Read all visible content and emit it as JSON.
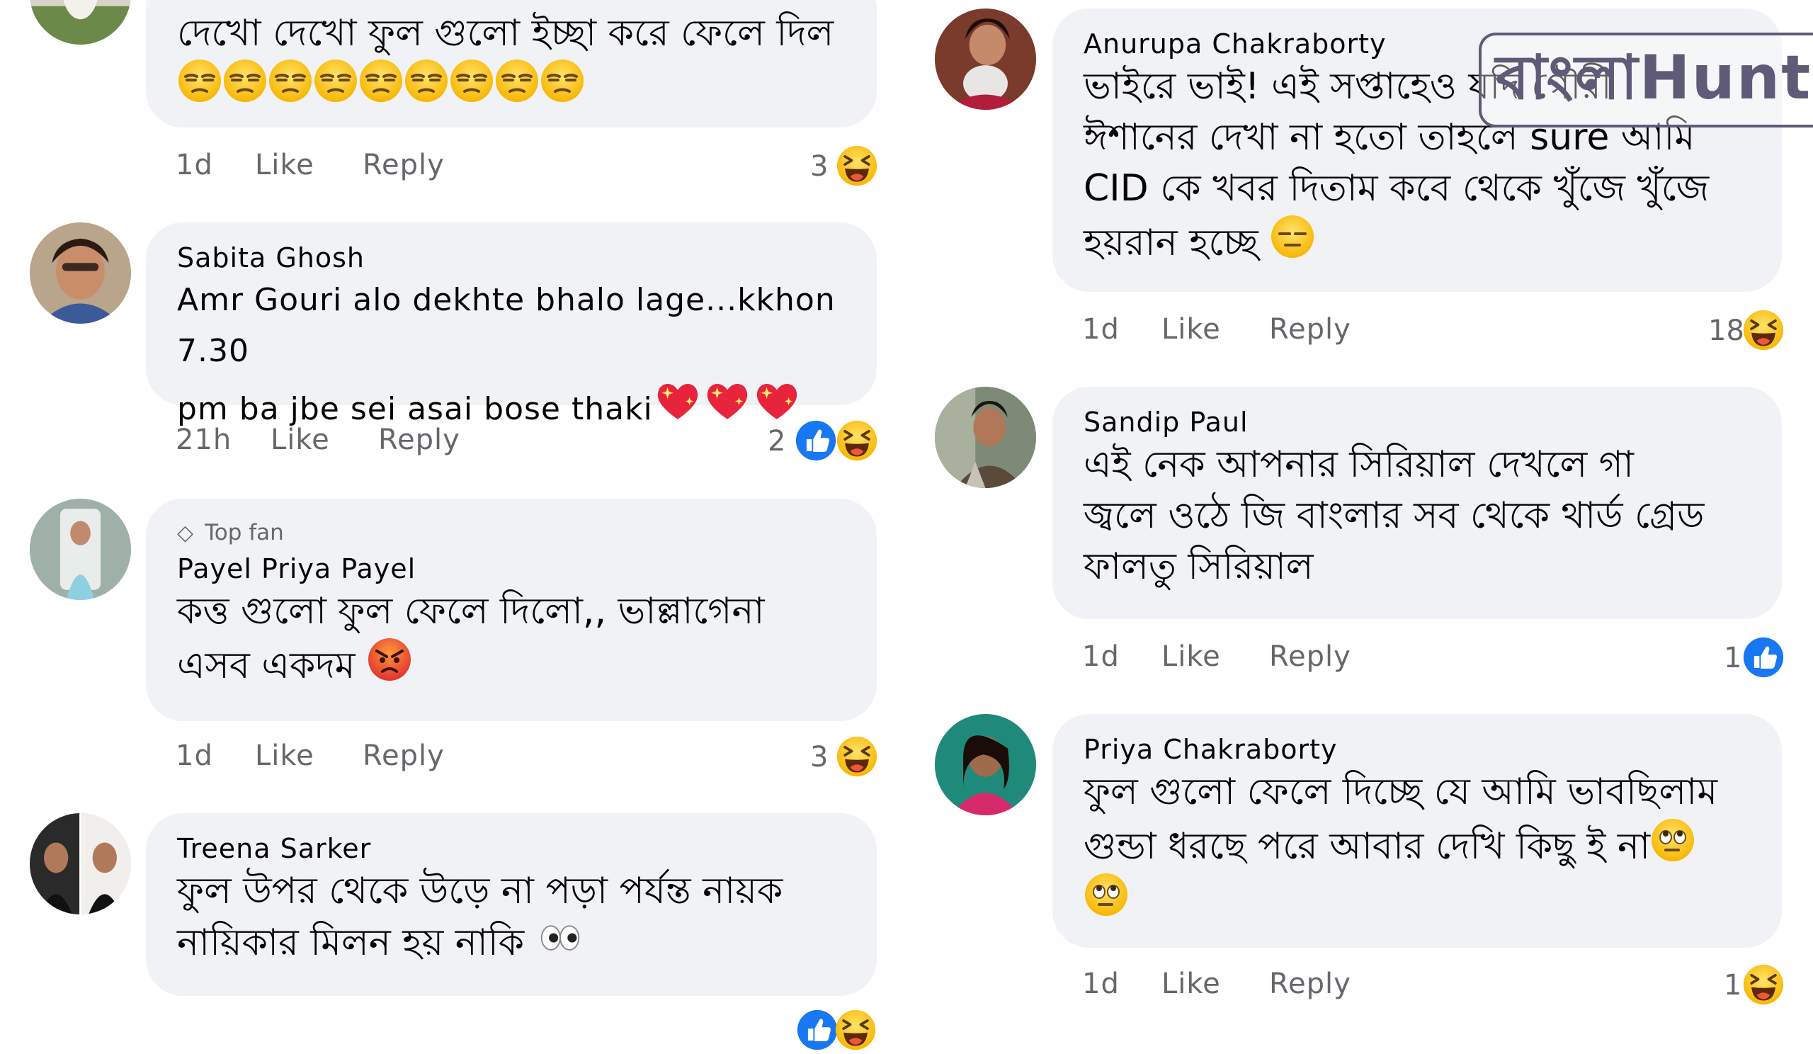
{
  "watermark": {
    "text": "বাংলাHunt"
  },
  "comments": [
    {
      "id": "c1",
      "name": "",
      "text": "দেখো দেখো ফুল গুলো ইচ্ছা করে ফেলে দিল",
      "emojis": [
        "unamused",
        "unamused",
        "unamused",
        "unamused",
        "unamused",
        "unamused",
        "unamused",
        "unamused",
        "unamused"
      ],
      "time": "1d",
      "like": "Like",
      "reply": "Reply",
      "reaction_count": "3",
      "reactions": [
        "haha"
      ]
    },
    {
      "id": "c2",
      "name": "Sabita Ghosh",
      "text_line1": "Amr Gouri alo dekhte bhalo lage...kkhon 7.30",
      "text_line2": "pm ba jbe sei asai bose thaki",
      "emojis": [
        "sparkling-heart",
        "sparkling-heart",
        "sparkling-heart"
      ],
      "time": "21h",
      "like": "Like",
      "reply": "Reply",
      "reaction_count": "2",
      "reactions": [
        "like",
        "haha"
      ]
    },
    {
      "id": "c3",
      "badge": "Top fan",
      "name": "Payel Priya Payel",
      "text_line1": "কত্ত গুলো ফুল ফেলে দিলো,, ভাল্লাগেনা",
      "text_line2": "এসব একদম",
      "emojis": [
        "angry"
      ],
      "time": "1d",
      "like": "Like",
      "reply": "Reply",
      "reaction_count": "3",
      "reactions": [
        "haha"
      ]
    },
    {
      "id": "c4",
      "name": "Treena Sarker",
      "text_line1": "ফুল উপর থেকে উড়ে না পড়া পর্যন্ত নায়ক",
      "text_line2": "নায়িকার মিলন হয় নাকি",
      "emojis": [
        "eyes"
      ]
    },
    {
      "id": "c5",
      "name": "Anurupa Chakraborty",
      "text_line1": "ভাইরে ভাই! এই সপ্তাহেও যদি গৌরী",
      "text_line2": "ঈশানের দেখা না হতো তাহলে sure আমি",
      "text_line3": "CID কে খবর দিতাম কবে থেকে খুঁজে খুঁজে",
      "text_line4": "হয়রান হচ্ছে",
      "emojis": [
        "expressionless"
      ],
      "time": "1d",
      "like": "Like",
      "reply": "Reply",
      "reaction_count": "18",
      "reactions": [
        "haha"
      ]
    },
    {
      "id": "c6",
      "name": "Sandip Paul",
      "text_line1": "এই নেক আপনার সিরিয়াল দেখলে গা",
      "text_line2": "জ্বলে ওঠে জি বাংলার সব থেকে থার্ড গ্রেড",
      "text_line3": "ফালতু সিরিয়াল",
      "time": "1d",
      "like": "Like",
      "reply": "Reply",
      "reaction_count": "1",
      "reactions": [
        "like"
      ]
    },
    {
      "id": "c7",
      "name": "Priya Chakraborty",
      "text_line1": "ফুল গুলো ফেলে দিচ্ছে যে আমি ভাবছিলাম",
      "text_line2": "গুন্ডা ধরছে পরে আবার দেখি কিছু ই না",
      "emojis": [
        "rolling-eyes",
        "rolling-eyes"
      ],
      "time": "1d",
      "like": "Like",
      "reply": "Reply",
      "reaction_count": "1",
      "reactions": [
        "haha"
      ]
    }
  ],
  "colors": {
    "bubble": "#f0f2f5",
    "meta_text": "#65676b",
    "like_blue": "#1877f2",
    "emoji_yellow": "#fcc21b",
    "watermark": "#5f5a78"
  }
}
